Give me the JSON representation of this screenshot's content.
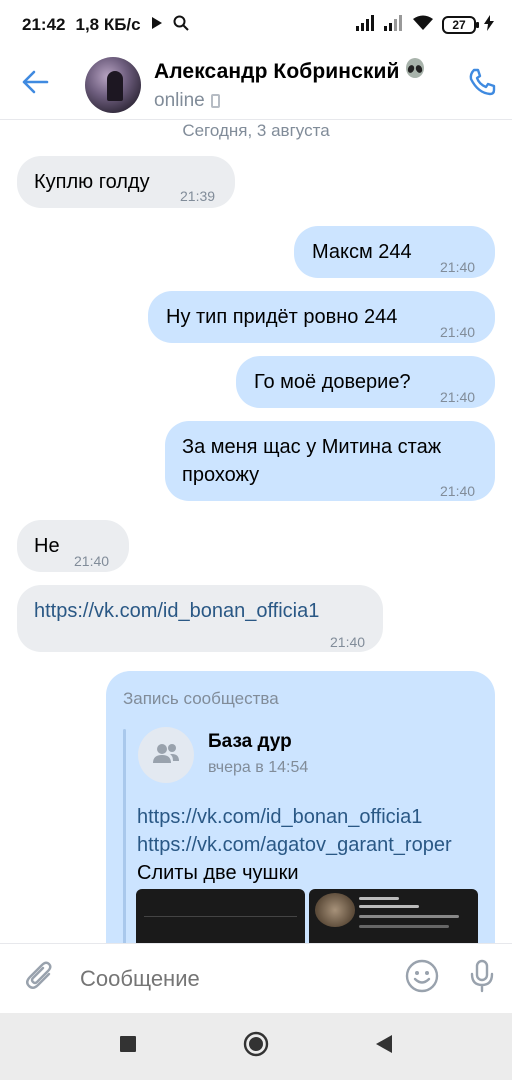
{
  "status_bar": {
    "time": "21:42",
    "speed": "1,8 КБ/с",
    "battery": "27"
  },
  "header": {
    "name": "Александр Кобринский",
    "status": "online"
  },
  "chat": {
    "date_separator": "Сегодня, 3 августа",
    "messages": [
      {
        "dir": "in",
        "text": "Куплю голду",
        "time": "21:39"
      },
      {
        "dir": "out",
        "text": "Максм 244",
        "time": "21:40"
      },
      {
        "dir": "out",
        "text": "Ну тип придёт ровно 244",
        "time": "21:40"
      },
      {
        "dir": "out",
        "text": "Го моё доверие?",
        "time": "21:40"
      },
      {
        "dir": "out",
        "text_line1": "За меня щас у Митина стаж",
        "text_line2": "прохожу",
        "time": "21:40"
      },
      {
        "dir": "in",
        "text": "Не",
        "time": "21:40"
      },
      {
        "dir": "in",
        "text": "https://vk.com/id_bonan_officia1",
        "time": "21:40"
      }
    ],
    "repost": {
      "label": "Запись сообщества",
      "group_name": "База дур",
      "date": "вчера в 14:54",
      "link1": "https://vk.com/id_bonan_officia1",
      "link2": "https://vk.com/agatov_garant_roper",
      "text": "Слиты две чушки"
    }
  },
  "composer": {
    "placeholder": "Сообщение"
  },
  "colors": {
    "accent": "#3f8ae0",
    "incoming_bubble": "#ebedf0",
    "outgoing_bubble": "#cce4ff",
    "secondary_text": "#818c99",
    "link": "#2a5885"
  }
}
